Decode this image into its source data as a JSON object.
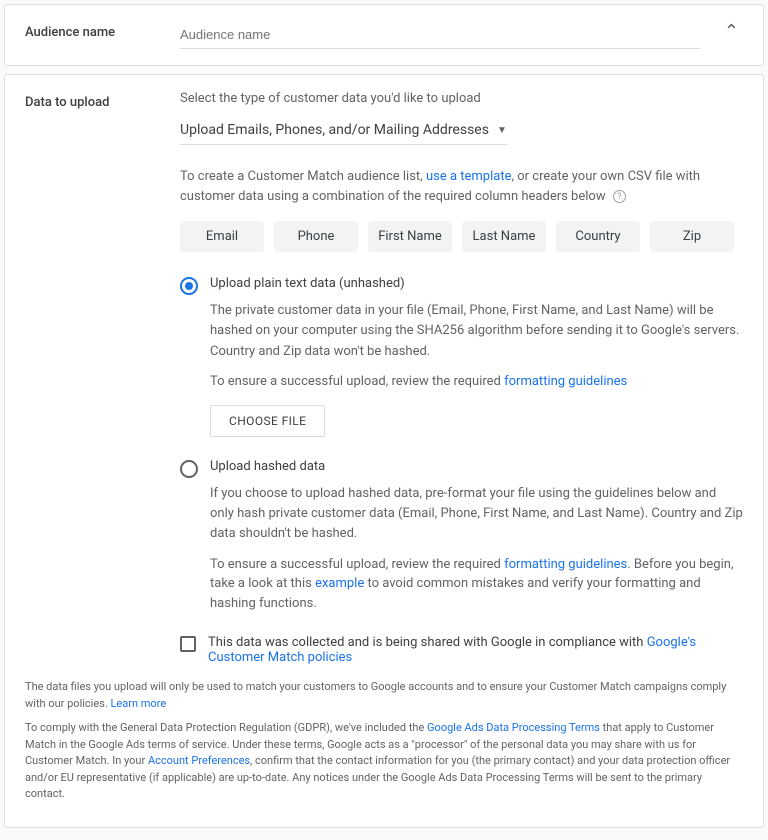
{
  "audience": {
    "section_label": "Audience name",
    "placeholder": "Audience name",
    "value": ""
  },
  "upload": {
    "section_label": "Data to upload",
    "instruction": "Select the type of customer data you'd like to upload",
    "dropdown_value": "Upload Emails, Phones, and/or Mailing Addresses",
    "intro_a": "To create a Customer Match audience list, ",
    "intro_link": "use a template",
    "intro_b": ", or create your own CSV file with customer data using a combination of the required column headers below",
    "chips": [
      "Email",
      "Phone",
      "First Name",
      "Last Name",
      "Country",
      "Zip"
    ],
    "radio_plain": {
      "title": "Upload plain text data (unhashed)",
      "desc": "The private customer data in your file (Email, Phone, First Name, and Last Name) will be hashed on your computer using the SHA256 algorithm before sending it to Google's servers. Country and Zip data won't be hashed.",
      "hint_a": "To ensure a successful upload, review the required ",
      "hint_link": "formatting guidelines",
      "choose_file": "CHOOSE FILE"
    },
    "radio_hashed": {
      "title": "Upload hashed data",
      "desc": "If you choose to upload hashed data, pre-format your file using the guidelines below and only hash private customer data (Email, Phone, First Name, and Last Name). Country and Zip data shouldn't be hashed.",
      "hint_a": "To ensure a successful upload, review the required ",
      "hint_link1": "formatting guidelines",
      "hint_b": ". Before you begin, take a look at this ",
      "hint_link2": "example",
      "hint_c": " to avoid common mistakes and verify your formatting and hashing functions."
    },
    "compliance": {
      "text": "This data was collected and is being shared with Google in compliance with ",
      "link": "Google's Customer Match policies"
    },
    "fine1_a": "The data files you upload will only be used to match your customers to Google accounts and to ensure your Customer Match campaigns comply with our policies. ",
    "fine1_link": "Learn more",
    "fine2_a": "To comply with the General Data Protection Regulation (GDPR), we've included the ",
    "fine2_link1": "Google Ads Data Processing Terms",
    "fine2_b": " that apply to Customer Match in the Google Ads terms of service. Under these terms, Google acts as a \"processor\" of the personal data you may share with us for Customer Match. In your ",
    "fine2_link2": "Account Preferences",
    "fine2_c": ", confirm that the contact information for you (the primary contact) and your data protection officer and/or EU representative (if applicable) are up-to-date. Any notices under the Google Ads Data Processing Terms will be sent to the primary contact."
  }
}
